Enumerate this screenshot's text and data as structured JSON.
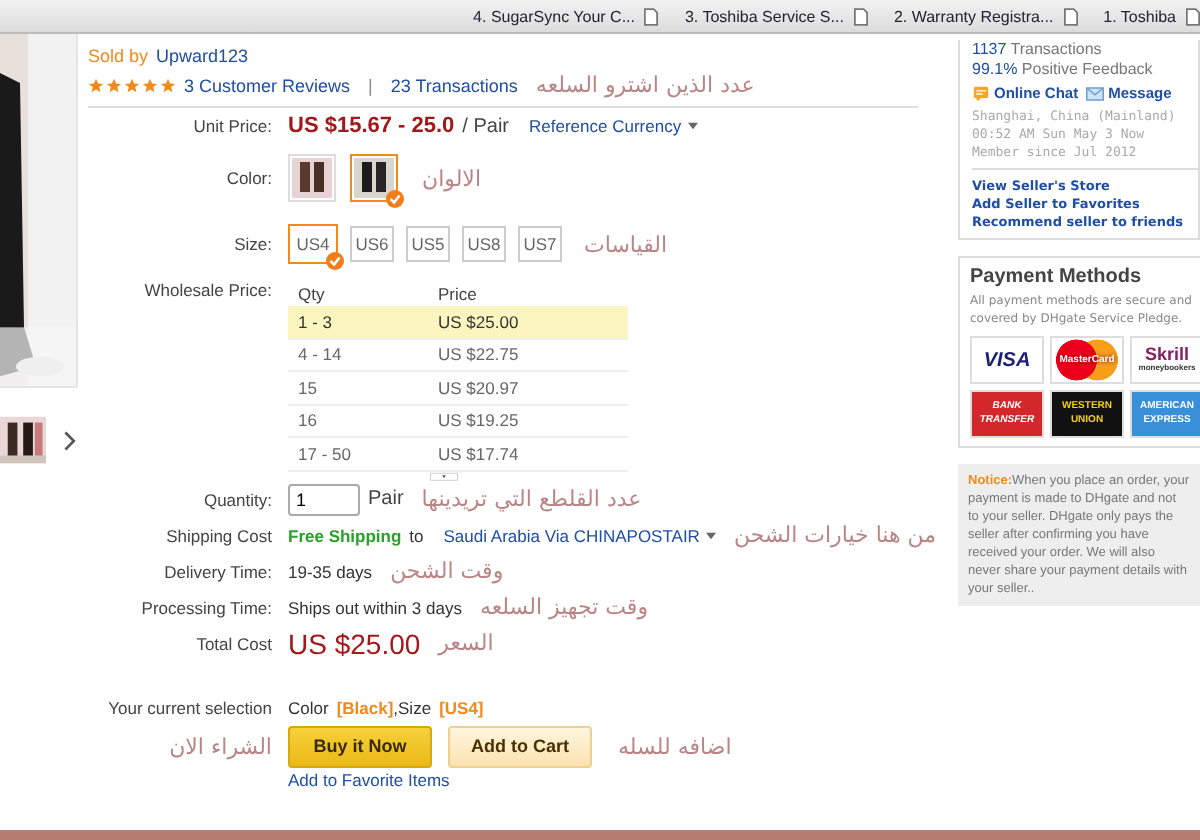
{
  "browser_tabs": [
    {
      "label": "4. SugarSync Your C..."
    },
    {
      "label": "3. Toshiba Service S..."
    },
    {
      "label": "2. Warranty Registra..."
    },
    {
      "label": "1. Toshiba"
    }
  ],
  "seller": {
    "sold_by_label": "Sold by",
    "name": "Upward123"
  },
  "rating": {
    "stars": 5,
    "reviews": "3 Customer Reviews",
    "separator": "|",
    "transactions": "23 Transactions",
    "note": "عدد الذين اشترو السلعه"
  },
  "unit_price": {
    "label": "Unit Price:",
    "price": "US $15.67 - 25.0",
    "unit": "/ Pair",
    "currency_link": "Reference Currency"
  },
  "color": {
    "label": "Color:",
    "options": [
      {
        "selected": false
      },
      {
        "selected": true
      }
    ],
    "note": "الالوان"
  },
  "size": {
    "label": "Size:",
    "options": [
      {
        "label": "US4",
        "selected": true
      },
      {
        "label": "US6",
        "selected": false
      },
      {
        "label": "US5",
        "selected": false
      },
      {
        "label": "US8",
        "selected": false
      },
      {
        "label": "US7",
        "selected": false
      }
    ],
    "note": "القياسات"
  },
  "wholesale": {
    "label": "Wholesale Price:",
    "columns": [
      "Qty",
      "Price"
    ],
    "rows": [
      {
        "qty": "1 - 3",
        "price": "US $25.00",
        "selected": true
      },
      {
        "qty": "4 - 14",
        "price": "US $22.75",
        "selected": false
      },
      {
        "qty": "15",
        "price": "US $20.97",
        "selected": false
      },
      {
        "qty": "16",
        "price": "US $19.25",
        "selected": false
      },
      {
        "qty": "17 - 50",
        "price": "US $17.74",
        "selected": false
      }
    ]
  },
  "quantity": {
    "label": "Quantity:",
    "value": "1",
    "unit": "Pair",
    "note": "عدد القلطع التي تريدينها"
  },
  "shipping": {
    "label": "Shipping Cost",
    "free": "Free Shipping",
    "to": "to",
    "destination": "Saudi Arabia Via CHINAPOSTAIR",
    "note": "من هنا خيارات الشحن"
  },
  "delivery": {
    "label": "Delivery Time:",
    "value": "19-35 days",
    "note": "وقت الشحن"
  },
  "processing": {
    "label": "Processing Time:",
    "value": "Ships out within 3 days",
    "note": "وقت تجهيز السلعه"
  },
  "total": {
    "label": "Total Cost",
    "value": "US $25.00",
    "note": "السعر"
  },
  "selection": {
    "label": "Your current selection",
    "color_label": "Color",
    "color_value": "[Black]",
    "size_label": ",Size",
    "size_value": "[US4]"
  },
  "buttons": [
    {
      "label": "Buy it Now",
      "kind": "primary"
    },
    {
      "label": "Add to Cart",
      "kind": "secondary"
    }
  ],
  "buy_note": "الشراء الان",
  "cart_note": "اضافه للسله",
  "favorite_link": "Add to Favorite Items",
  "seller_box": {
    "transactions_count": "1137",
    "transactions_label": "Transactions",
    "feedback_pct": "99.1%",
    "feedback_label": "Positive Feedback",
    "chat": "Online Chat",
    "message": "Message",
    "location": "Shanghai, China (Mainland)",
    "time": "00:52 AM Sun May 3 Now",
    "member": "Member since Jul 2012",
    "links": [
      "View Seller's Store",
      "Add Seller to Favorites",
      "Recommend seller to friends"
    ]
  },
  "payment": {
    "title": "Payment Methods",
    "description": "All payment methods are secure and covered by DHgate Service Pledge.",
    "methods": [
      {
        "kind": "visa",
        "label": "VISA"
      },
      {
        "kind": "mastercard",
        "label": "MasterCard"
      },
      {
        "kind": "skrill",
        "label": "Skrill",
        "sub": "moneybookers"
      },
      {
        "kind": "bank",
        "label": "BANK TRANSFER"
      },
      {
        "kind": "western",
        "label": "WESTERN UNION"
      },
      {
        "kind": "amex",
        "label": "AMERICAN EXPRESS"
      }
    ]
  },
  "notice": {
    "label": "Notice:",
    "text": "When you place an order, your payment is made to DHgate and not to your seller. DHgate only pays the seller after confirming you have received your order. We will also never share your payment details with your seller.."
  }
}
